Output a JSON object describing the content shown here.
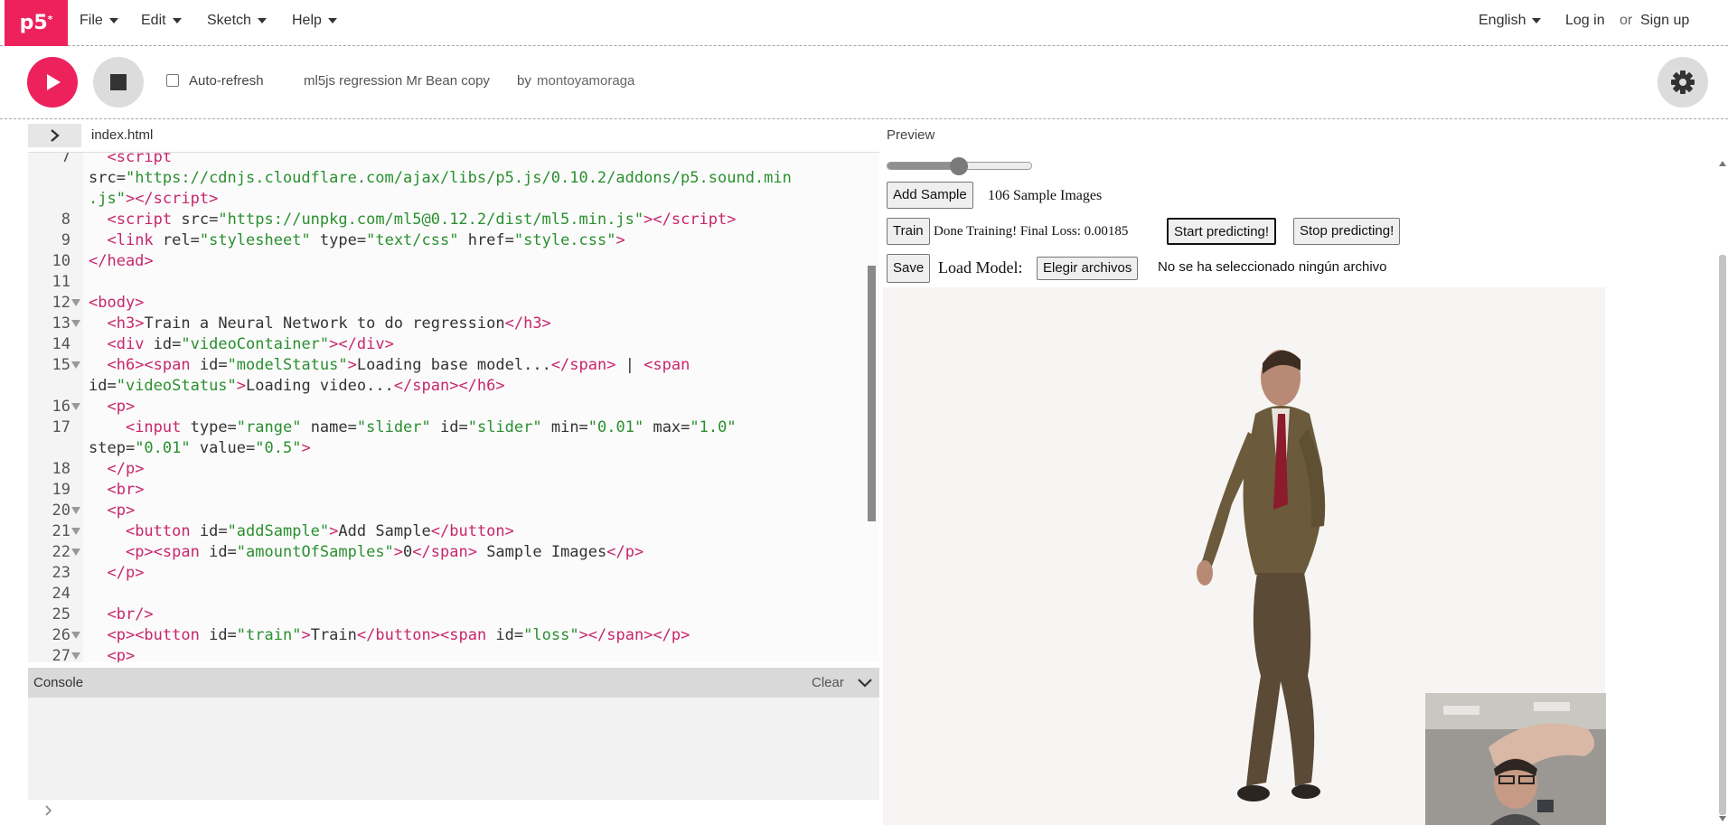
{
  "app": {
    "logo": "p5",
    "logo_mark": "*"
  },
  "nav": {
    "menus": [
      {
        "label": "File",
        "icon": "chevron-down-icon"
      },
      {
        "label": "Edit",
        "icon": "chevron-down-icon"
      },
      {
        "label": "Sketch",
        "icon": "chevron-down-icon"
      },
      {
        "label": "Help",
        "icon": "chevron-down-icon"
      }
    ],
    "language": "English",
    "login": "Log in",
    "or": "or",
    "signup": "Sign up"
  },
  "toolbar": {
    "play_icon": "play-icon",
    "stop_icon": "stop-icon",
    "auto_refresh_label": "Auto-refresh",
    "auto_refresh_checked": false,
    "sketch_title": "ml5js regression Mr Bean copy",
    "by": "by",
    "owner": "montoyamoraga",
    "settings_icon": "gear-icon"
  },
  "editor": {
    "file_name": "index.html",
    "lines": [
      {
        "n": "7",
        "fold": false,
        "html": "  <span class='t'>&lt;script</span>"
      },
      {
        "n": "",
        "fold": false,
        "html": "src=<span class='s'>\"https://cdnjs.cloudflare.com/ajax/libs/p5.js/0.10.2/addons/p5.sound.min</span>"
      },
      {
        "n": "",
        "fold": false,
        "html": "<span class='s'>.js\"</span><span class='t'>&gt;&lt;/script&gt;</span>"
      },
      {
        "n": "8",
        "fold": false,
        "html": "  <span class='t'>&lt;script</span> src=<span class='s'>\"https://unpkg.com/ml5@0.12.2/dist/ml5.min.js\"</span><span class='t'>&gt;&lt;/script&gt;</span>"
      },
      {
        "n": "9",
        "fold": false,
        "html": "  <span class='t'>&lt;link</span> rel=<span class='s'>\"stylesheet\"</span> type=<span class='s'>\"text/css\"</span> href=<span class='s'>\"style.css\"</span><span class='t'>&gt;</span>"
      },
      {
        "n": "10",
        "fold": false,
        "html": "<span class='t'>&lt;/head&gt;</span>"
      },
      {
        "n": "11",
        "fold": false,
        "html": ""
      },
      {
        "n": "12",
        "fold": true,
        "html": "<span class='t'>&lt;body&gt;</span>"
      },
      {
        "n": "13",
        "fold": true,
        "html": "  <span class='t'>&lt;h3&gt;</span>Train a Neural Network to do regression<span class='t'>&lt;/h3&gt;</span>"
      },
      {
        "n": "14",
        "fold": false,
        "html": "  <span class='t'>&lt;div</span> id=<span class='s'>\"videoContainer\"</span><span class='t'>&gt;&lt;/div&gt;</span>"
      },
      {
        "n": "15",
        "fold": true,
        "html": "  <span class='t'>&lt;h6&gt;&lt;span</span> id=<span class='s'>\"modelStatus\"</span><span class='t'>&gt;</span>Loading base model...<span class='t'>&lt;/span&gt;</span> | <span class='t'>&lt;span</span>"
      },
      {
        "n": "",
        "fold": false,
        "html": "id=<span class='s'>\"videoStatus\"</span><span class='t'>&gt;</span>Loading video...<span class='t'>&lt;/span&gt;&lt;/h6&gt;</span>"
      },
      {
        "n": "16",
        "fold": true,
        "html": "  <span class='t'>&lt;p&gt;</span>"
      },
      {
        "n": "17",
        "fold": false,
        "html": "    <span class='t'>&lt;input</span> type=<span class='s'>\"range\"</span> name=<span class='s'>\"slider\"</span> id=<span class='s'>\"slider\"</span> min=<span class='s'>\"0.01\"</span> max=<span class='s'>\"1.0\"</span>"
      },
      {
        "n": "",
        "fold": false,
        "html": "step=<span class='s'>\"0.01\"</span> value=<span class='s'>\"0.5\"</span><span class='t'>&gt;</span>"
      },
      {
        "n": "18",
        "fold": false,
        "html": "  <span class='t'>&lt;/p&gt;</span>"
      },
      {
        "n": "19",
        "fold": false,
        "html": "  <span class='t'>&lt;br&gt;</span>"
      },
      {
        "n": "20",
        "fold": true,
        "html": "  <span class='t'>&lt;p&gt;</span>"
      },
      {
        "n": "21",
        "fold": true,
        "html": "    <span class='t'>&lt;button</span> id=<span class='s'>\"addSample\"</span><span class='t'>&gt;</span>Add Sample<span class='t'>&lt;/button&gt;</span>"
      },
      {
        "n": "22",
        "fold": true,
        "html": "    <span class='t'>&lt;p&gt;&lt;span</span> id=<span class='s'>\"amountOfSamples\"</span><span class='t'>&gt;</span>0<span class='t'>&lt;/span&gt;</span> Sample Images<span class='t'>&lt;/p&gt;</span>"
      },
      {
        "n": "23",
        "fold": false,
        "html": "  <span class='t'>&lt;/p&gt;</span>"
      },
      {
        "n": "24",
        "fold": false,
        "html": ""
      },
      {
        "n": "25",
        "fold": false,
        "html": "  <span class='t'>&lt;br/&gt;</span>"
      },
      {
        "n": "26",
        "fold": true,
        "html": "  <span class='t'>&lt;p&gt;&lt;button</span> id=<span class='s'>\"train\"</span><span class='t'>&gt;</span>Train<span class='t'>&lt;/button&gt;&lt;span</span> id=<span class='s'>\"loss\"</span><span class='t'>&gt;&lt;/span&gt;&lt;/p&gt;</span>"
      },
      {
        "n": "27",
        "fold": true,
        "html": "  <span class='t'>&lt;p&gt;</span>"
      }
    ]
  },
  "console": {
    "title": "Console",
    "clear": "Clear",
    "collapse_icon": "chevron-down-icon",
    "prompt_icon": "chevron-right-icon"
  },
  "preview": {
    "label": "Preview",
    "slider_value": 0.5,
    "slider_min": 0.01,
    "slider_max": 1.0,
    "add_sample": "Add Sample",
    "sample_count": "106 Sample Images",
    "train": "Train",
    "loss_text": "Done Training! Final Loss: 0.00185",
    "start_predicting": "Start predicting!",
    "stop_predicting": "Stop predicting!",
    "save": "Save",
    "load_model_label": "Load Model:",
    "choose_files": "Elegir archivos",
    "no_file": "No se ha seleccionado ningún archivo"
  },
  "colors": {
    "accent": "#ed225d",
    "tag": "#c7266b",
    "string": "#2a8f2f"
  }
}
